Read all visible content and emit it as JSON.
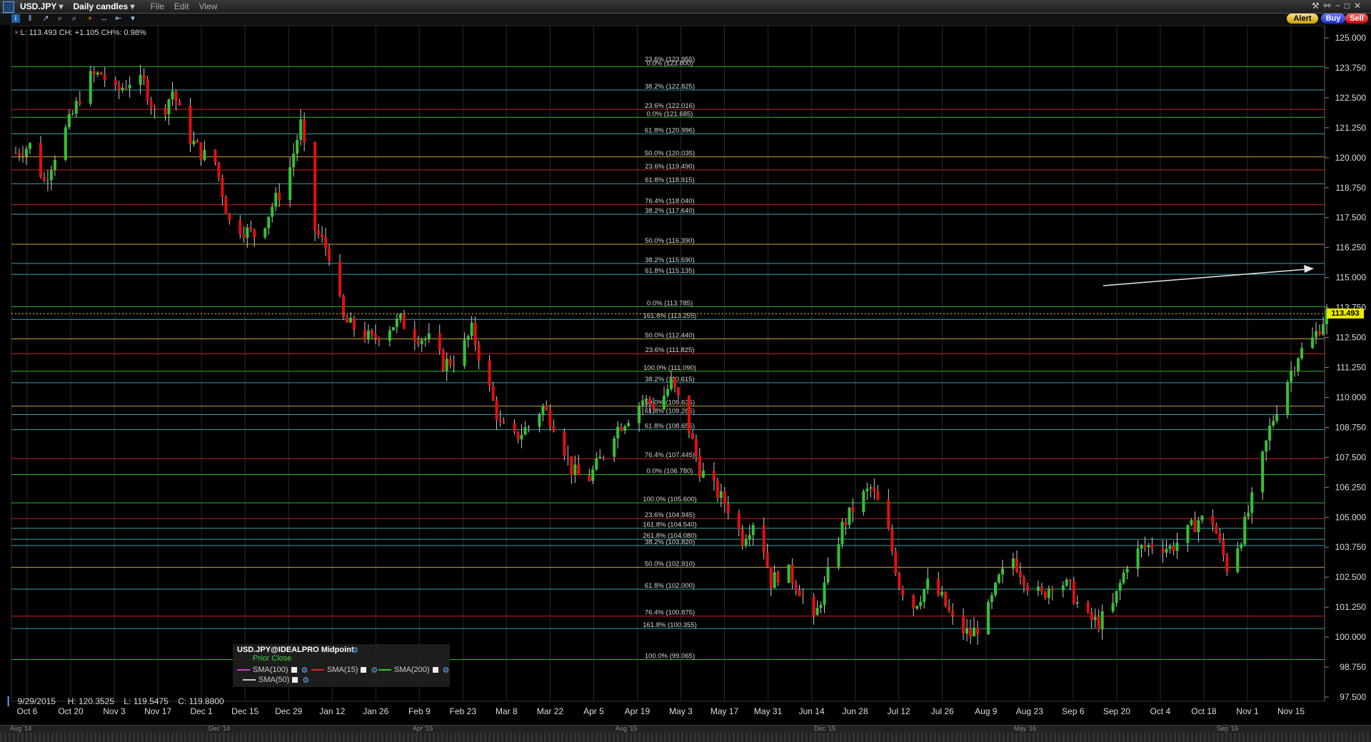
{
  "window": {
    "symbol": "USD.JPY",
    "chart_type": "Daily candles",
    "menus": [
      "File",
      "Edit",
      "View"
    ],
    "buttons": {
      "alert": "Alert",
      "buy": "Buy",
      "sell": "Sell"
    }
  },
  "info_line": "L: 113.493 CH: +1.105 CH%: 0.98%",
  "legend": {
    "title": "USD.JPY@IDEALPRO Midpoint",
    "prior_close": "Prior Close",
    "sma100": "SMA(100)",
    "sma15": "SMA(15)",
    "sma200": "SMA(200)",
    "sma50": "SMA(50)"
  },
  "ohlc": {
    "date": "9/29/2015",
    "high": "H: 120.3525",
    "low": "L: 119.5475",
    "close": "C: 119.8800"
  },
  "navigator_labels": [
    "Aug '14",
    "Dec '14",
    "Apr '15",
    "Aug '15",
    "Dec '15",
    "May '16",
    "Sep '16"
  ],
  "colors": {
    "up": "#33c233",
    "down": "#e01010",
    "wick": "#cccccc",
    "price_tag": "#e8e800"
  },
  "chart_data": {
    "type": "candlestick",
    "title": "",
    "xlabel": "",
    "ylabel": "",
    "ylim": [
      97.0,
      125.5
    ],
    "last_price": "113.493",
    "y_ticks": [
      "125.000",
      "123.750",
      "122.500",
      "121.250",
      "120.000",
      "118.750",
      "117.500",
      "116.250",
      "115.000",
      "113.750",
      "112.500",
      "111.250",
      "110.000",
      "108.750",
      "107.500",
      "106.250",
      "105.000",
      "103.750",
      "102.500",
      "101.250",
      "100.000",
      "98.750",
      "97.500"
    ],
    "x_ticks": [
      "Oct 6",
      "Oct 20",
      "Nov 3",
      "Nov 17",
      "Dec 1",
      "Dec 15",
      "Dec 29",
      "Jan 12",
      "Jan 26",
      "Feb 9",
      "Feb 23",
      "Mar 8",
      "Mar 22",
      "Apr 5",
      "Apr 19",
      "May 3",
      "May 17",
      "May 31",
      "Jun 14",
      "Jun 28",
      "Jul 12",
      "Jul 26",
      "Aug 9",
      "Aug 23",
      "Sep 6",
      "Sep 20",
      "Oct 4",
      "Oct 18",
      "Nov 1",
      "Nov 15"
    ],
    "close_path": [
      [
        0,
        120.2
      ],
      [
        4,
        120.5
      ],
      [
        8,
        119.0
      ],
      [
        12,
        120.5
      ],
      [
        16,
        121.8
      ],
      [
        20,
        123.3
      ],
      [
        24,
        123.5
      ],
      [
        28,
        122.7
      ],
      [
        32,
        123.2
      ],
      [
        36,
        123.1
      ],
      [
        40,
        121.5
      ],
      [
        44,
        122.8
      ],
      [
        48,
        121.0
      ],
      [
        52,
        120.2
      ],
      [
        56,
        119.8
      ],
      [
        60,
        117.3
      ],
      [
        64,
        117.0
      ],
      [
        68,
        116.7
      ],
      [
        72,
        118.0
      ],
      [
        76,
        119.0
      ],
      [
        80,
        121.4
      ],
      [
        84,
        117.0
      ],
      [
        88,
        116.0
      ],
      [
        92,
        113.2
      ],
      [
        96,
        112.8
      ],
      [
        100,
        112.4
      ],
      [
        104,
        112.9
      ],
      [
        108,
        113.2
      ],
      [
        112,
        112.6
      ],
      [
        116,
        112.4
      ],
      [
        120,
        111.4
      ],
      [
        124,
        111.6
      ],
      [
        128,
        112.8
      ],
      [
        132,
        110.8
      ],
      [
        136,
        108.8
      ],
      [
        140,
        108.3
      ],
      [
        144,
        108.8
      ],
      [
        148,
        109.6
      ],
      [
        152,
        108.7
      ],
      [
        156,
        107.0
      ],
      [
        160,
        106.4
      ],
      [
        164,
        107.4
      ],
      [
        168,
        108.6
      ],
      [
        172,
        109.2
      ],
      [
        176,
        109.9
      ],
      [
        180,
        109.6
      ],
      [
        184,
        110.6
      ],
      [
        188,
        109.2
      ],
      [
        192,
        107.0
      ],
      [
        196,
        106.2
      ],
      [
        200,
        105.4
      ],
      [
        204,
        104.1
      ],
      [
        208,
        105.1
      ],
      [
        212,
        102.3
      ],
      [
        216,
        102.9
      ],
      [
        220,
        102.0
      ],
      [
        224,
        100.6
      ],
      [
        228,
        102.6
      ],
      [
        232,
        104.6
      ],
      [
        236,
        105.6
      ],
      [
        240,
        106.2
      ],
      [
        244,
        105.0
      ],
      [
        248,
        102.2
      ],
      [
        252,
        101.3
      ],
      [
        256,
        102.2
      ],
      [
        260,
        101.6
      ],
      [
        264,
        100.4
      ],
      [
        268,
        100.1
      ],
      [
        272,
        100.7
      ],
      [
        276,
        102.4
      ],
      [
        280,
        103.3
      ],
      [
        284,
        102.2
      ],
      [
        288,
        101.7
      ],
      [
        292,
        102.5
      ],
      [
        296,
        102.0
      ],
      [
        300,
        100.8
      ],
      [
        304,
        100.6
      ],
      [
        308,
        101.3
      ],
      [
        312,
        103.1
      ],
      [
        316,
        103.7
      ],
      [
        320,
        103.9
      ],
      [
        324,
        103.7
      ],
      [
        328,
        104.2
      ],
      [
        332,
        104.9
      ],
      [
        336,
        104.8
      ],
      [
        340,
        102.9
      ],
      [
        344,
        104.2
      ],
      [
        348,
        106.2
      ],
      [
        352,
        108.7
      ],
      [
        356,
        110.4
      ],
      [
        360,
        111.8
      ],
      [
        364,
        112.4
      ],
      [
        368,
        113.5
      ]
    ],
    "fib_levels": [
      {
        "label": "23.6% (123.955)",
        "y": 123.955,
        "line": false
      },
      {
        "label": "0.0% (123.800)",
        "y": 123.8,
        "line": true,
        "color": "#2db82d"
      },
      {
        "label": "38.2% (122.825)",
        "y": 122.825,
        "line": true,
        "color": "#3aa0a8"
      },
      {
        "label": "23.6% (122.016)",
        "y": 122.016,
        "line": true,
        "color": "#d02020"
      },
      {
        "label": "0.0% (121.685)",
        "y": 121.685,
        "line": true,
        "color": "#2db82d"
      },
      {
        "label": "61.8% (120.996)",
        "y": 120.996,
        "line": true,
        "color": "#3aa0a8"
      },
      {
        "label": "50.0% (120.035)",
        "y": 120.035,
        "line": true,
        "color": "#c8a040"
      },
      {
        "label": "23.6% (119.490)",
        "y": 119.49,
        "line": true,
        "color": "#d02020"
      },
      {
        "label": "61.8% (118.915)",
        "y": 118.915,
        "line": true,
        "color": "#3aa0a8"
      },
      {
        "label": "76.4% (118.040)",
        "y": 118.04,
        "line": true,
        "color": "#d02020"
      },
      {
        "label": "38.2% (117.640)",
        "y": 117.64,
        "line": true,
        "color": "#3aa0a8"
      },
      {
        "label": "50.0% (116.390)",
        "y": 116.39,
        "line": true,
        "color": "#c8a040"
      },
      {
        "label": "38.2% (115.590)",
        "y": 115.59,
        "line": true,
        "color": "#3aa0a8"
      },
      {
        "label": "61.8% (115.135)",
        "y": 115.135,
        "line": true,
        "color": "#3aa0a8"
      },
      {
        "label": "0.0% (113.785)",
        "y": 113.785,
        "line": true,
        "color": "#2db82d"
      },
      {
        "label": "161.8% (113.255)",
        "y": 113.255,
        "line": true,
        "color": "#3aa0a8"
      },
      {
        "label": "50.0% (112.440)",
        "y": 112.44,
        "line": true,
        "color": "#c8a040"
      },
      {
        "label": "23.6% (111.825)",
        "y": 111.825,
        "line": true,
        "color": "#d02020"
      },
      {
        "label": "100.0% (111.090)",
        "y": 111.09,
        "line": true,
        "color": "#2db82d"
      },
      {
        "label": "38.2% (110.615)",
        "y": 110.615,
        "line": true,
        "color": "#3aa0a8"
      },
      {
        "label": "50.0% (109.635)",
        "y": 109.635,
        "line": true,
        "color": "#c8a040"
      },
      {
        "label": "61.8% (109.285)",
        "y": 109.285,
        "line": true,
        "color": "#3aa0a8"
      },
      {
        "label": "61.8% (108.655)",
        "y": 108.655,
        "line": true,
        "color": "#3aa0a8"
      },
      {
        "label": "76.4% (107.445)",
        "y": 107.445,
        "line": true,
        "color": "#d02020"
      },
      {
        "label": "0.0% (106.780)",
        "y": 106.78,
        "line": true,
        "color": "#2db82d"
      },
      {
        "label": "100.0% (105.600)",
        "y": 105.6,
        "line": true,
        "color": "#2db82d"
      },
      {
        "label": "23.6% (104.945)",
        "y": 104.945,
        "line": true,
        "color": "#d02020"
      },
      {
        "label": "161.8% (104.540)",
        "y": 104.54,
        "line": true,
        "color": "#3aa0a8"
      },
      {
        "label": "261.8% (104.080)",
        "y": 104.08,
        "line": true,
        "color": "#3aa0a8"
      },
      {
        "label": "38.2% (103.820)",
        "y": 103.82,
        "line": true,
        "color": "#3aa0a8"
      },
      {
        "label": "50.0% (102.910)",
        "y": 102.91,
        "line": true,
        "color": "#c8a040"
      },
      {
        "label": "61.8% (102.000)",
        "y": 102.0,
        "line": true,
        "color": "#3aa0a8"
      },
      {
        "label": "76.4% (100.875)",
        "y": 100.875,
        "line": true,
        "color": "#d02020"
      },
      {
        "label": "161.8% (100.355)",
        "y": 100.355,
        "line": true,
        "color": "#3aa0a8"
      },
      {
        "label": "100.0% (99.065)",
        "y": 99.065,
        "line": true,
        "color": "#2db82d"
      }
    ]
  }
}
